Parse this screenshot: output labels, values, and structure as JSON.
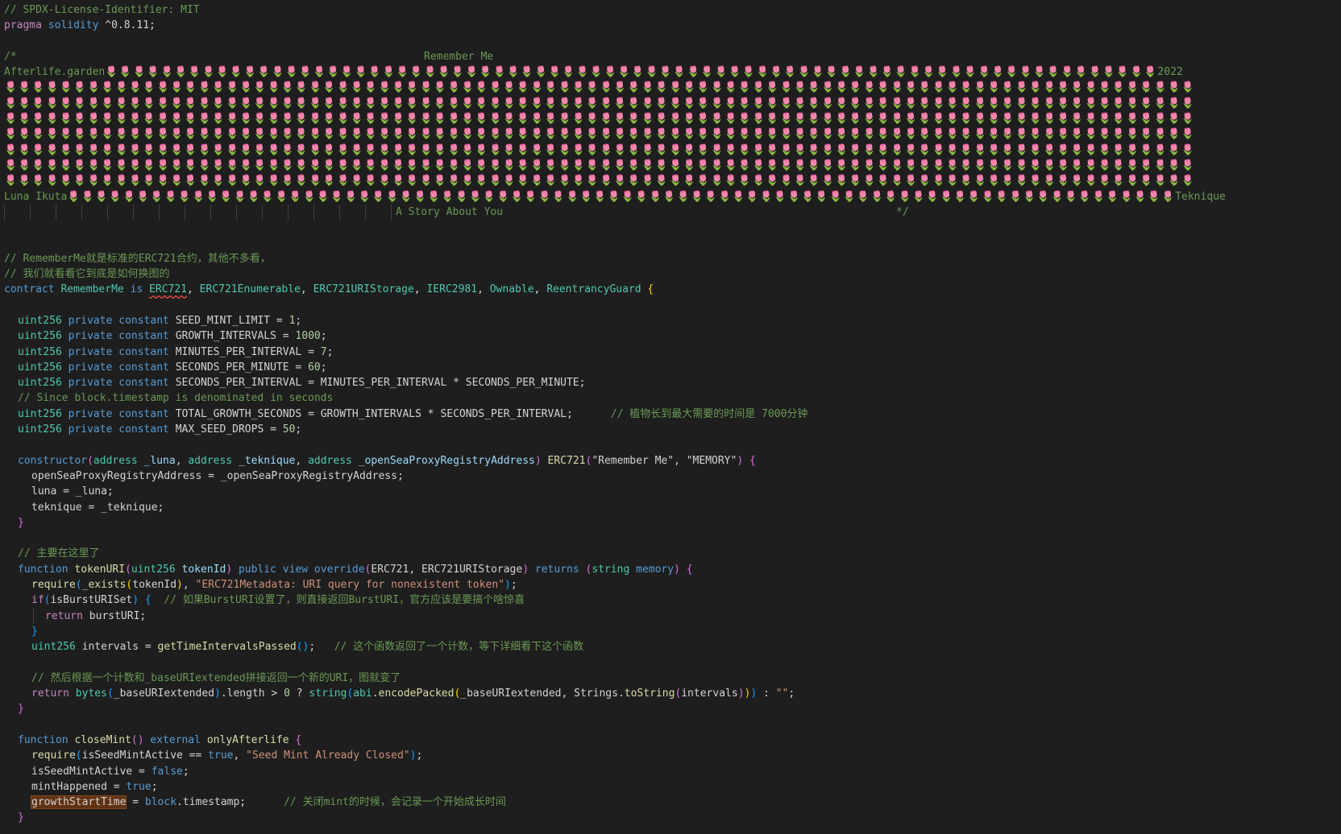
{
  "editor": {
    "license": "// SPDX-License-Identifier: MIT",
    "pragma_kw": "pragma",
    "pragma_lang": "solidity",
    "pragma_ver": " ^0.8.11;",
    "art": {
      "open": "/*",
      "title": "Remember Me",
      "left_label_1": "Afterlife.garden",
      "right_label_1": "2022",
      "left_label_2": "Luna Ikuta",
      "right_label_2": "Teknique",
      "story": "A Story About You",
      "close": "*/",
      "flower_glyph": "🌷",
      "flower_color": "#e05c9a"
    },
    "comments": {
      "cn1": "// RememberMe就是标准的ERC721合约，其他不多看，",
      "cn2": "// 我们就看看它到底是如何换图的",
      "since": "// Since block.timestamp is denominated in seconds",
      "growth_time": "// 植物长到最大需要的时间是 7000分钟",
      "main_here": "// 主要在这里了",
      "burst": "// 如果BurstURI设置了，则直接返回BurstURI，官方应该是要搞个啥惊喜",
      "intervals": "// 这个函数返回了一个计数，等下详细看下这个函数",
      "then": "// 然后根据一个计数和_baseURIextended拼接返回一个新的URI，图就变了",
      "close_mint": "// 关闭mint的时候，会记录一个开始成长时间"
    },
    "contract": {
      "kw": "contract",
      "name": "RememberMe",
      "is": "is",
      "bases": [
        "ERC721",
        "ERC721Enumerable",
        "ERC721URIStorage",
        "IERC2981",
        "Ownable",
        "ReentrancyGuard"
      ]
    },
    "constants": [
      {
        "name": "SEED_MINT_LIMIT",
        "value": "1"
      },
      {
        "name": "GROWTH_INTERVALS",
        "value": "1000"
      },
      {
        "name": "MINUTES_PER_INTERVAL",
        "value": "7"
      },
      {
        "name": "SECONDS_PER_MINUTE",
        "value": "60"
      },
      {
        "name": "SECONDS_PER_INTERVAL",
        "expr": "MINUTES_PER_INTERVAL * SECONDS_PER_MINUTE"
      },
      {
        "name": "TOTAL_GROWTH_SECONDS",
        "expr": "GROWTH_INTERVALS * SECONDS_PER_INTERVAL"
      },
      {
        "name": "MAX_SEED_DROPS",
        "value": "50"
      }
    ],
    "strings": {
      "remember_me": "\"Remember Me\"",
      "memory_sym": "\"MEMORY\"",
      "erc_err": "\"ERC721Metadata: URI query for nonexistent token\"",
      "seed_closed": "\"Seed Mint Already Closed\"",
      "empty": "\"\""
    }
  }
}
